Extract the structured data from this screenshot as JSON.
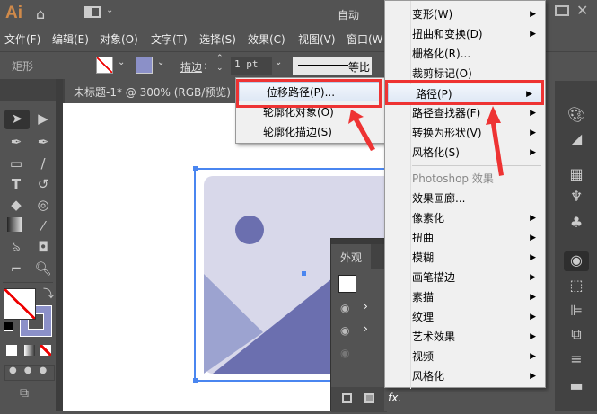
{
  "app": {
    "logo": "Ai",
    "workspace": "自动"
  },
  "menubar": [
    "文件(F)",
    "编辑(E)",
    "对象(O)",
    "文字(T)",
    "选择(S)",
    "效果(C)",
    "视图(V)",
    "窗口(W"
  ],
  "control": {
    "object_type": "矩形",
    "stroke_label": "描边",
    "stroke_value": "1 pt",
    "profile": "等比"
  },
  "document": {
    "tab_title": "未标题-1* @ 300% (RGB/预览)"
  },
  "path_submenu": {
    "items": [
      "位移路径(P)...",
      "轮廓化对象(O)",
      "轮廓化描边(S)"
    ],
    "highlighted": 0
  },
  "effect_menu": {
    "illustrator_items": [
      {
        "label": "变形(W)",
        "sub": true
      },
      {
        "label": "扭曲和变换(D)",
        "sub": true
      },
      {
        "label": "栅格化(R)...",
        "sub": false
      },
      {
        "label": "裁剪标记(O)",
        "sub": false
      },
      {
        "label": "路径(P)",
        "sub": true
      },
      {
        "label": "路径查找器(F)",
        "sub": true
      },
      {
        "label": "转换为形状(V)",
        "sub": true
      },
      {
        "label": "风格化(S)",
        "sub": true
      }
    ],
    "photoshop_header": "Photoshop 效果",
    "photoshop_items": [
      {
        "label": "效果画廊...",
        "sub": false
      },
      {
        "label": "像素化",
        "sub": true
      },
      {
        "label": "扭曲",
        "sub": true
      },
      {
        "label": "模糊",
        "sub": true
      },
      {
        "label": "画笔描边",
        "sub": true
      },
      {
        "label": "素描",
        "sub": true
      },
      {
        "label": "纹理",
        "sub": true
      },
      {
        "label": "艺术效果",
        "sub": true
      },
      {
        "label": "视频",
        "sub": true
      },
      {
        "label": "风格化",
        "sub": true
      }
    ],
    "highlighted": "路径(P)"
  },
  "appearance_panel": {
    "tab": "外观",
    "fx_label": "fx."
  },
  "colors": {
    "accent_red": "#ee3333",
    "art_light": "#d8d8ea",
    "art_mid": "#9ca3d0",
    "art_dark": "#6b6faf",
    "selection": "#4a86f0"
  }
}
